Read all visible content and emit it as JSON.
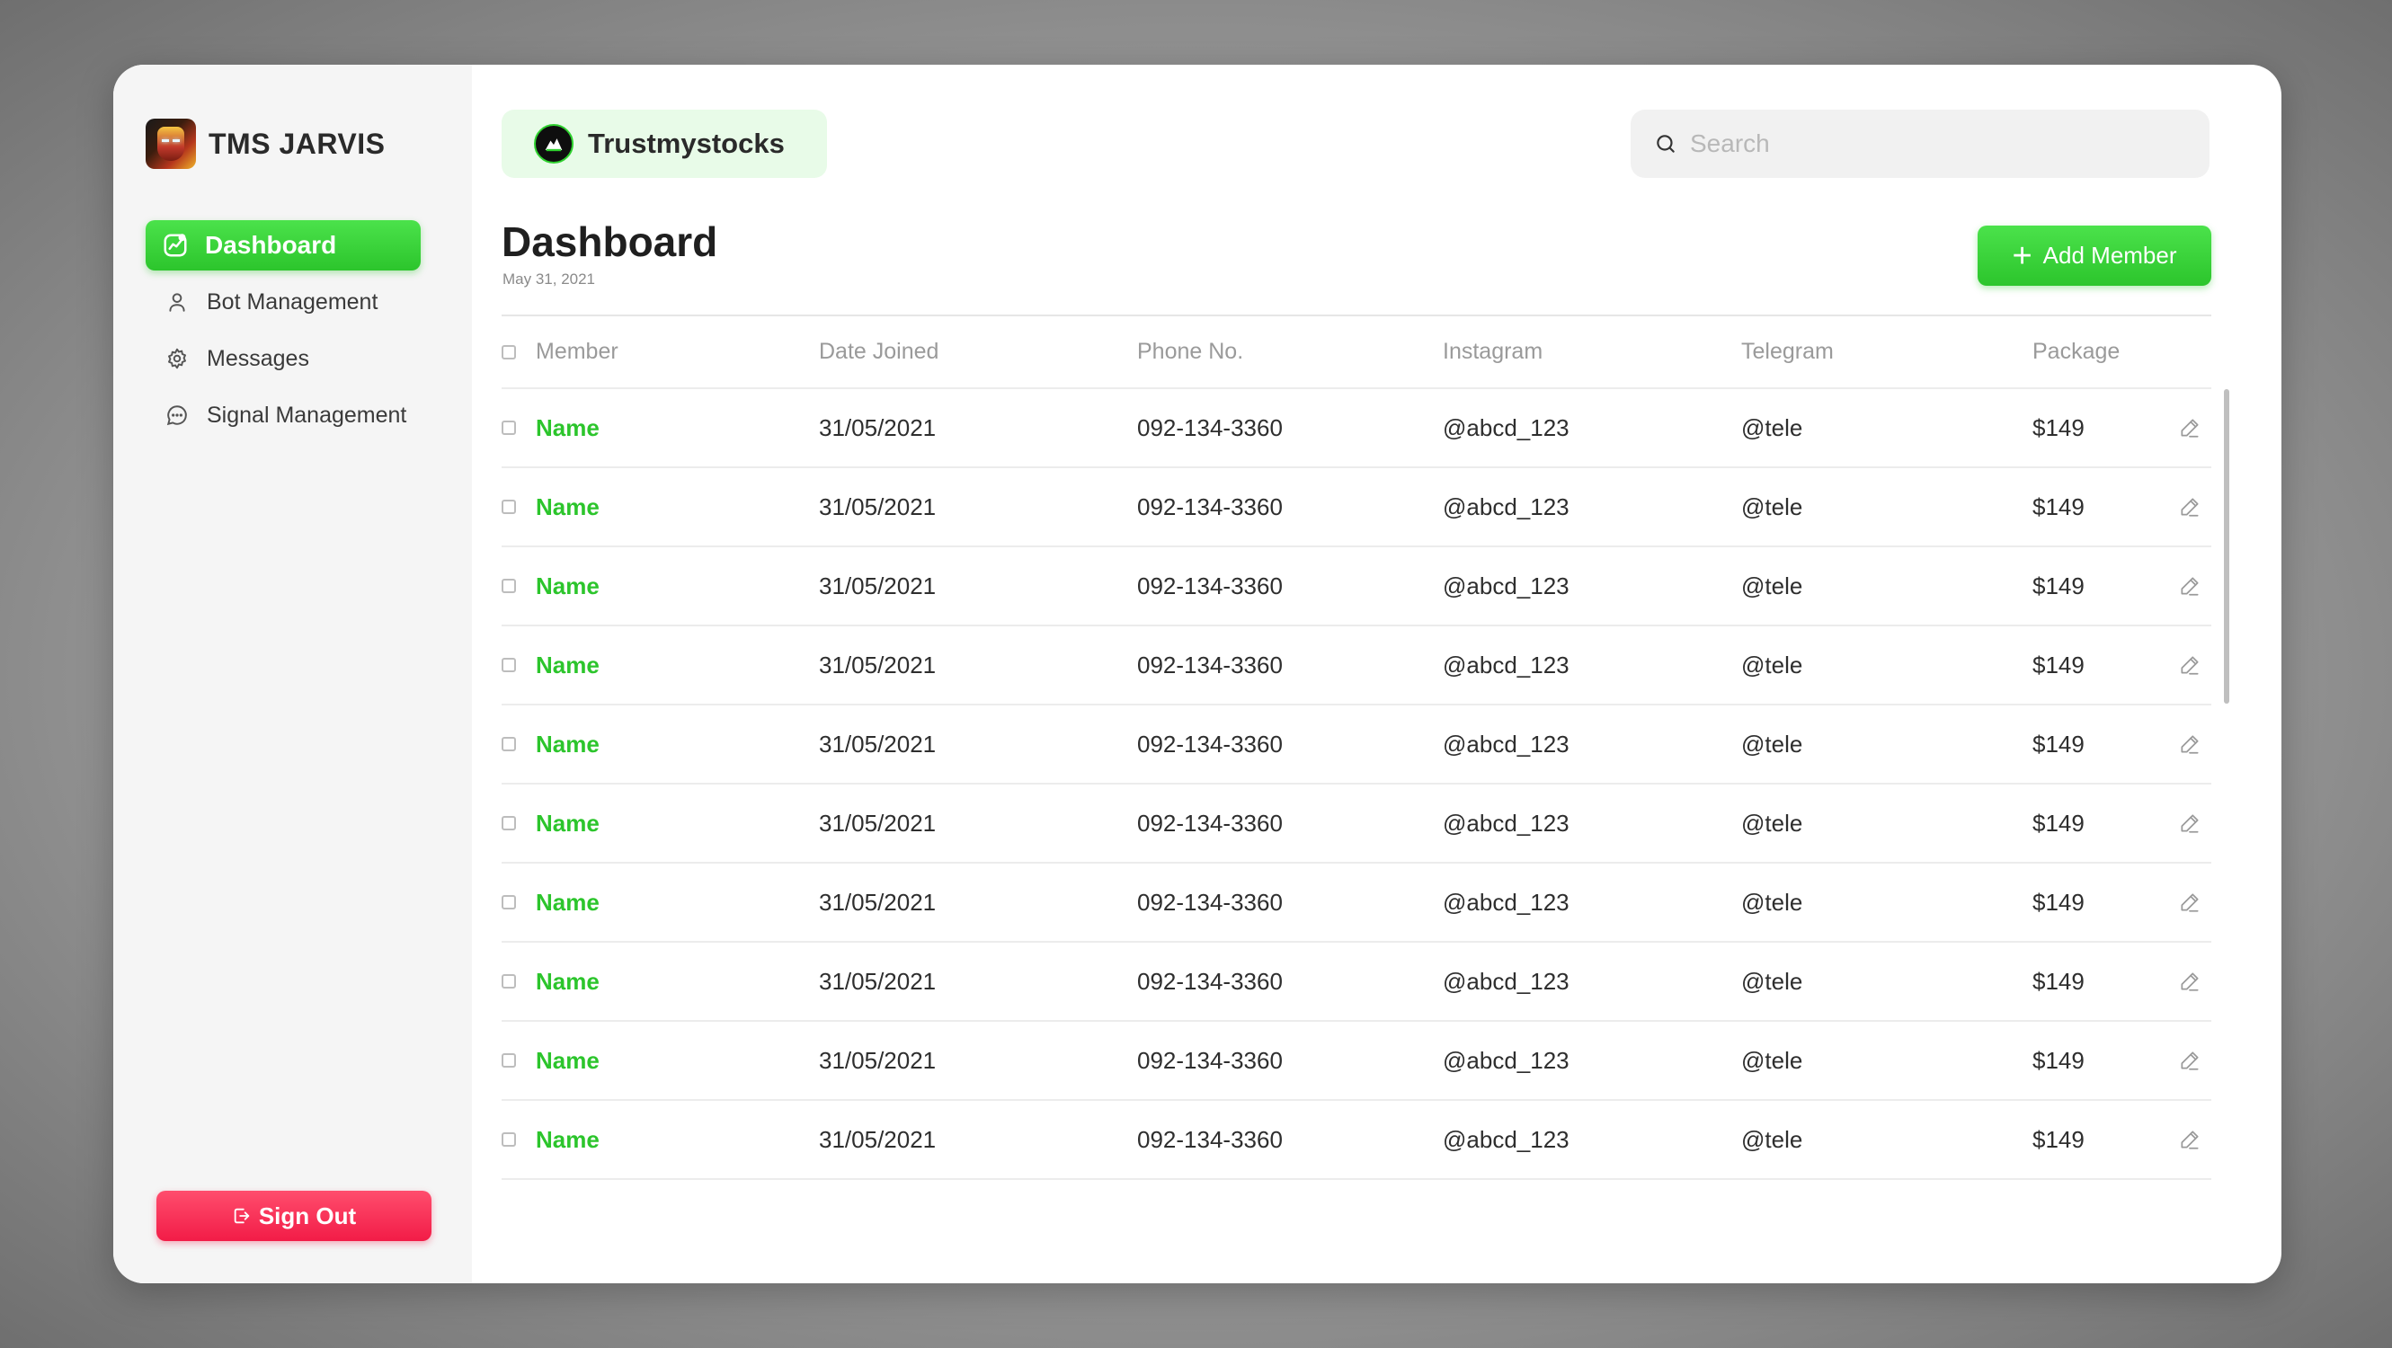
{
  "brand": {
    "name": "TMS JARVIS"
  },
  "sidebar": {
    "items": [
      {
        "label": "Dashboard",
        "icon": "chart-icon",
        "active": true
      },
      {
        "label": "Bot Management",
        "icon": "user-icon",
        "active": false
      },
      {
        "label": "Messages",
        "icon": "gear-icon",
        "active": false
      },
      {
        "label": "Signal Management",
        "icon": "chat-icon",
        "active": false
      }
    ],
    "sign_out_label": "Sign Out"
  },
  "header": {
    "org_name": "Trustmystocks",
    "search_placeholder": "Search"
  },
  "page": {
    "title": "Dashboard",
    "date": "May 31, 2021",
    "add_member_label": "Add Member"
  },
  "table": {
    "columns": [
      "Member",
      "Date Joined",
      "Phone No.",
      "Instagram",
      "Telegram",
      "Package"
    ],
    "rows": [
      {
        "member": "Name",
        "date_joined": "31/05/2021",
        "phone": "092-134-3360",
        "instagram": "@abcd_123",
        "telegram": "@tele",
        "package": "$149"
      },
      {
        "member": "Name",
        "date_joined": "31/05/2021",
        "phone": "092-134-3360",
        "instagram": "@abcd_123",
        "telegram": "@tele",
        "package": "$149"
      },
      {
        "member": "Name",
        "date_joined": "31/05/2021",
        "phone": "092-134-3360",
        "instagram": "@abcd_123",
        "telegram": "@tele",
        "package": "$149"
      },
      {
        "member": "Name",
        "date_joined": "31/05/2021",
        "phone": "092-134-3360",
        "instagram": "@abcd_123",
        "telegram": "@tele",
        "package": "$149"
      },
      {
        "member": "Name",
        "date_joined": "31/05/2021",
        "phone": "092-134-3360",
        "instagram": "@abcd_123",
        "telegram": "@tele",
        "package": "$149"
      },
      {
        "member": "Name",
        "date_joined": "31/05/2021",
        "phone": "092-134-3360",
        "instagram": "@abcd_123",
        "telegram": "@tele",
        "package": "$149"
      },
      {
        "member": "Name",
        "date_joined": "31/05/2021",
        "phone": "092-134-3360",
        "instagram": "@abcd_123",
        "telegram": "@tele",
        "package": "$149"
      },
      {
        "member": "Name",
        "date_joined": "31/05/2021",
        "phone": "092-134-3360",
        "instagram": "@abcd_123",
        "telegram": "@tele",
        "package": "$149"
      },
      {
        "member": "Name",
        "date_joined": "31/05/2021",
        "phone": "092-134-3360",
        "instagram": "@abcd_123",
        "telegram": "@tele",
        "package": "$149"
      },
      {
        "member": "Name",
        "date_joined": "31/05/2021",
        "phone": "092-134-3360",
        "instagram": "@abcd_123",
        "telegram": "@tele",
        "package": "$149"
      }
    ]
  },
  "colors": {
    "accent_green": "#2cc52c",
    "danger_red": "#f21c47",
    "org_pill_bg": "#e8fbe8"
  }
}
